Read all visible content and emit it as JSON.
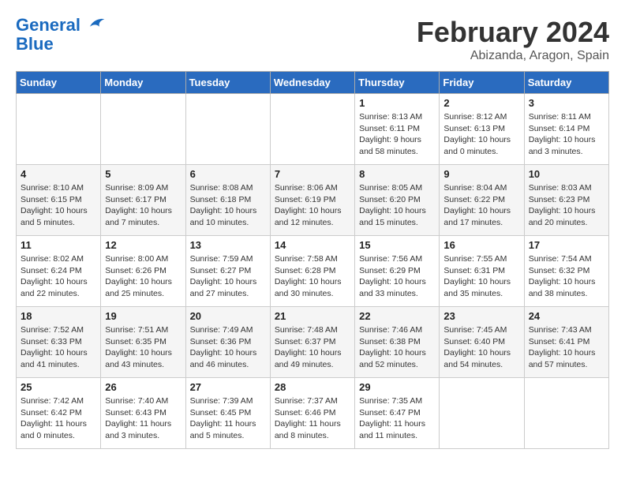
{
  "logo": {
    "line1": "General",
    "line2": "Blue"
  },
  "title": "February 2024",
  "location": "Abizanda, Aragon, Spain",
  "days_of_week": [
    "Sunday",
    "Monday",
    "Tuesday",
    "Wednesday",
    "Thursday",
    "Friday",
    "Saturday"
  ],
  "weeks": [
    [
      null,
      null,
      null,
      null,
      {
        "day": "1",
        "sunrise": "8:13 AM",
        "sunset": "6:11 PM",
        "daylight": "9 hours and 58 minutes."
      },
      {
        "day": "2",
        "sunrise": "8:12 AM",
        "sunset": "6:13 PM",
        "daylight": "10 hours and 0 minutes."
      },
      {
        "day": "3",
        "sunrise": "8:11 AM",
        "sunset": "6:14 PM",
        "daylight": "10 hours and 3 minutes."
      }
    ],
    [
      {
        "day": "4",
        "sunrise": "8:10 AM",
        "sunset": "6:15 PM",
        "daylight": "10 hours and 5 minutes."
      },
      {
        "day": "5",
        "sunrise": "8:09 AM",
        "sunset": "6:17 PM",
        "daylight": "10 hours and 7 minutes."
      },
      {
        "day": "6",
        "sunrise": "8:08 AM",
        "sunset": "6:18 PM",
        "daylight": "10 hours and 10 minutes."
      },
      {
        "day": "7",
        "sunrise": "8:06 AM",
        "sunset": "6:19 PM",
        "daylight": "10 hours and 12 minutes."
      },
      {
        "day": "8",
        "sunrise": "8:05 AM",
        "sunset": "6:20 PM",
        "daylight": "10 hours and 15 minutes."
      },
      {
        "day": "9",
        "sunrise": "8:04 AM",
        "sunset": "6:22 PM",
        "daylight": "10 hours and 17 minutes."
      },
      {
        "day": "10",
        "sunrise": "8:03 AM",
        "sunset": "6:23 PM",
        "daylight": "10 hours and 20 minutes."
      }
    ],
    [
      {
        "day": "11",
        "sunrise": "8:02 AM",
        "sunset": "6:24 PM",
        "daylight": "10 hours and 22 minutes."
      },
      {
        "day": "12",
        "sunrise": "8:00 AM",
        "sunset": "6:26 PM",
        "daylight": "10 hours and 25 minutes."
      },
      {
        "day": "13",
        "sunrise": "7:59 AM",
        "sunset": "6:27 PM",
        "daylight": "10 hours and 27 minutes."
      },
      {
        "day": "14",
        "sunrise": "7:58 AM",
        "sunset": "6:28 PM",
        "daylight": "10 hours and 30 minutes."
      },
      {
        "day": "15",
        "sunrise": "7:56 AM",
        "sunset": "6:29 PM",
        "daylight": "10 hours and 33 minutes."
      },
      {
        "day": "16",
        "sunrise": "7:55 AM",
        "sunset": "6:31 PM",
        "daylight": "10 hours and 35 minutes."
      },
      {
        "day": "17",
        "sunrise": "7:54 AM",
        "sunset": "6:32 PM",
        "daylight": "10 hours and 38 minutes."
      }
    ],
    [
      {
        "day": "18",
        "sunrise": "7:52 AM",
        "sunset": "6:33 PM",
        "daylight": "10 hours and 41 minutes."
      },
      {
        "day": "19",
        "sunrise": "7:51 AM",
        "sunset": "6:35 PM",
        "daylight": "10 hours and 43 minutes."
      },
      {
        "day": "20",
        "sunrise": "7:49 AM",
        "sunset": "6:36 PM",
        "daylight": "10 hours and 46 minutes."
      },
      {
        "day": "21",
        "sunrise": "7:48 AM",
        "sunset": "6:37 PM",
        "daylight": "10 hours and 49 minutes."
      },
      {
        "day": "22",
        "sunrise": "7:46 AM",
        "sunset": "6:38 PM",
        "daylight": "10 hours and 52 minutes."
      },
      {
        "day": "23",
        "sunrise": "7:45 AM",
        "sunset": "6:40 PM",
        "daylight": "10 hours and 54 minutes."
      },
      {
        "day": "24",
        "sunrise": "7:43 AM",
        "sunset": "6:41 PM",
        "daylight": "10 hours and 57 minutes."
      }
    ],
    [
      {
        "day": "25",
        "sunrise": "7:42 AM",
        "sunset": "6:42 PM",
        "daylight": "11 hours and 0 minutes."
      },
      {
        "day": "26",
        "sunrise": "7:40 AM",
        "sunset": "6:43 PM",
        "daylight": "11 hours and 3 minutes."
      },
      {
        "day": "27",
        "sunrise": "7:39 AM",
        "sunset": "6:45 PM",
        "daylight": "11 hours and 5 minutes."
      },
      {
        "day": "28",
        "sunrise": "7:37 AM",
        "sunset": "6:46 PM",
        "daylight": "11 hours and 8 minutes."
      },
      {
        "day": "29",
        "sunrise": "7:35 AM",
        "sunset": "6:47 PM",
        "daylight": "11 hours and 11 minutes."
      },
      null,
      null
    ]
  ]
}
